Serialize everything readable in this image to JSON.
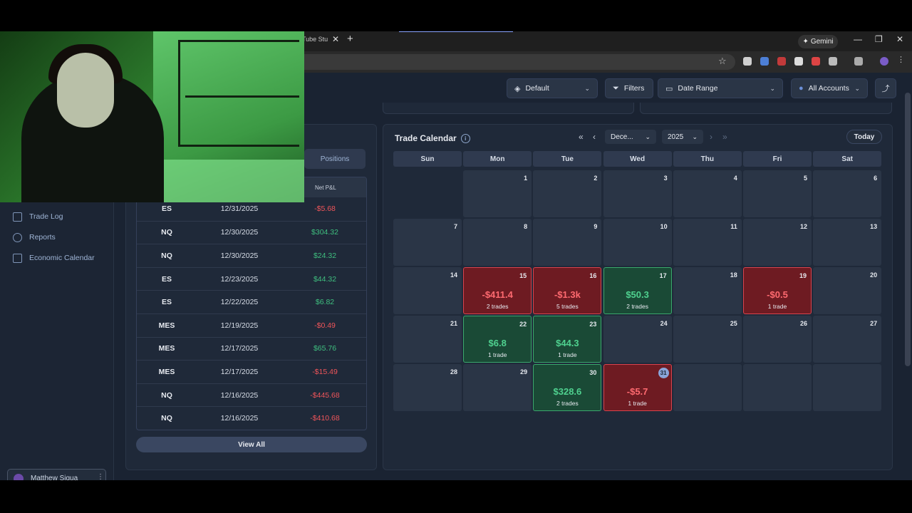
{
  "browser": {
    "tab_fragment": "Tube Stu",
    "tab_close": "✕",
    "new_tab": "+",
    "gemini_label": "Gemini",
    "minimize": "—",
    "restore": "❐",
    "close": "✕"
  },
  "toolbar": {
    "layout_label": "Default",
    "filters_label": "Filters",
    "date_range_label": "Date Range",
    "accounts_label": "All Accounts"
  },
  "sidebar": {
    "items": [
      {
        "label": "Trade Log"
      },
      {
        "label": "Reports"
      },
      {
        "label": "Economic Calendar"
      }
    ],
    "user_name": "Matthew Sigua"
  },
  "trades": {
    "positions_tab": "Positions",
    "pnl_header": "Net P&L",
    "rows": [
      {
        "symbol": "ES",
        "date": "12/31/2025",
        "pnl": "-$5.68",
        "sign": "neg"
      },
      {
        "symbol": "NQ",
        "date": "12/30/2025",
        "pnl": "$304.32",
        "sign": "pos"
      },
      {
        "symbol": "NQ",
        "date": "12/30/2025",
        "pnl": "$24.32",
        "sign": "pos"
      },
      {
        "symbol": "ES",
        "date": "12/23/2025",
        "pnl": "$44.32",
        "sign": "pos"
      },
      {
        "symbol": "ES",
        "date": "12/22/2025",
        "pnl": "$6.82",
        "sign": "pos"
      },
      {
        "symbol": "MES",
        "date": "12/19/2025",
        "pnl": "-$0.49",
        "sign": "neg"
      },
      {
        "symbol": "MES",
        "date": "12/17/2025",
        "pnl": "$65.76",
        "sign": "pos"
      },
      {
        "symbol": "MES",
        "date": "12/17/2025",
        "pnl": "-$15.49",
        "sign": "neg"
      },
      {
        "symbol": "NQ",
        "date": "12/16/2025",
        "pnl": "-$445.68",
        "sign": "neg"
      },
      {
        "symbol": "NQ",
        "date": "12/16/2025",
        "pnl": "-$410.68",
        "sign": "neg"
      }
    ],
    "view_all": "View All"
  },
  "calendar": {
    "title": "Trade Calendar",
    "info": "i",
    "first_label": "«",
    "prev_label": "‹",
    "next_label": "›",
    "last_label": "»",
    "month": "Dece...",
    "year": "2025",
    "today_label": "Today",
    "weekdays": [
      "Sun",
      "Mon",
      "Tue",
      "Wed",
      "Thu",
      "Fri",
      "Sat"
    ],
    "days": [
      {
        "n": "1",
        "col": 1,
        "row": 0
      },
      {
        "n": "2",
        "col": 2,
        "row": 0
      },
      {
        "n": "3",
        "col": 3,
        "row": 0
      },
      {
        "n": "4",
        "col": 4,
        "row": 0
      },
      {
        "n": "5",
        "col": 5,
        "row": 0
      },
      {
        "n": "6",
        "col": 6,
        "row": 0
      },
      {
        "n": "7",
        "col": 0,
        "row": 1
      },
      {
        "n": "8",
        "col": 1,
        "row": 1
      },
      {
        "n": "9",
        "col": 2,
        "row": 1
      },
      {
        "n": "10",
        "col": 3,
        "row": 1
      },
      {
        "n": "11",
        "col": 4,
        "row": 1
      },
      {
        "n": "12",
        "col": 5,
        "row": 1
      },
      {
        "n": "13",
        "col": 6,
        "row": 1
      },
      {
        "n": "14",
        "col": 0,
        "row": 2
      },
      {
        "n": "15",
        "col": 1,
        "row": 2,
        "status": "red",
        "value": "-$411.4",
        "count": "2 trades"
      },
      {
        "n": "16",
        "col": 2,
        "row": 2,
        "status": "red",
        "value": "-$1.3k",
        "count": "5 trades"
      },
      {
        "n": "17",
        "col": 3,
        "row": 2,
        "status": "green",
        "value": "$50.3",
        "count": "2 trades"
      },
      {
        "n": "18",
        "col": 4,
        "row": 2
      },
      {
        "n": "19",
        "col": 5,
        "row": 2,
        "status": "red",
        "value": "-$0.5",
        "count": "1 trade"
      },
      {
        "n": "20",
        "col": 6,
        "row": 2
      },
      {
        "n": "21",
        "col": 0,
        "row": 3
      },
      {
        "n": "22",
        "col": 1,
        "row": 3,
        "status": "green",
        "value": "$6.8",
        "count": "1 trade"
      },
      {
        "n": "23",
        "col": 2,
        "row": 3,
        "status": "green",
        "value": "$44.3",
        "count": "1 trade"
      },
      {
        "n": "24",
        "col": 3,
        "row": 3
      },
      {
        "n": "25",
        "col": 4,
        "row": 3
      },
      {
        "n": "26",
        "col": 5,
        "row": 3
      },
      {
        "n": "27",
        "col": 6,
        "row": 3
      },
      {
        "n": "28",
        "col": 0,
        "row": 4
      },
      {
        "n": "29",
        "col": 1,
        "row": 4
      },
      {
        "n": "30",
        "col": 2,
        "row": 4,
        "status": "green",
        "value": "$328.6",
        "count": "2 trades"
      },
      {
        "n": "31",
        "col": 3,
        "row": 4,
        "status": "red",
        "value": "-$5.7",
        "count": "1 trade",
        "today": true
      },
      {
        "n": "",
        "col": 4,
        "row": 4
      },
      {
        "n": "",
        "col": 5,
        "row": 4
      },
      {
        "n": "",
        "col": 6,
        "row": 4
      }
    ]
  },
  "colors": {
    "profit": "#3fbf7f",
    "loss": "#f0555a",
    "app_bg": "#1a2332"
  }
}
